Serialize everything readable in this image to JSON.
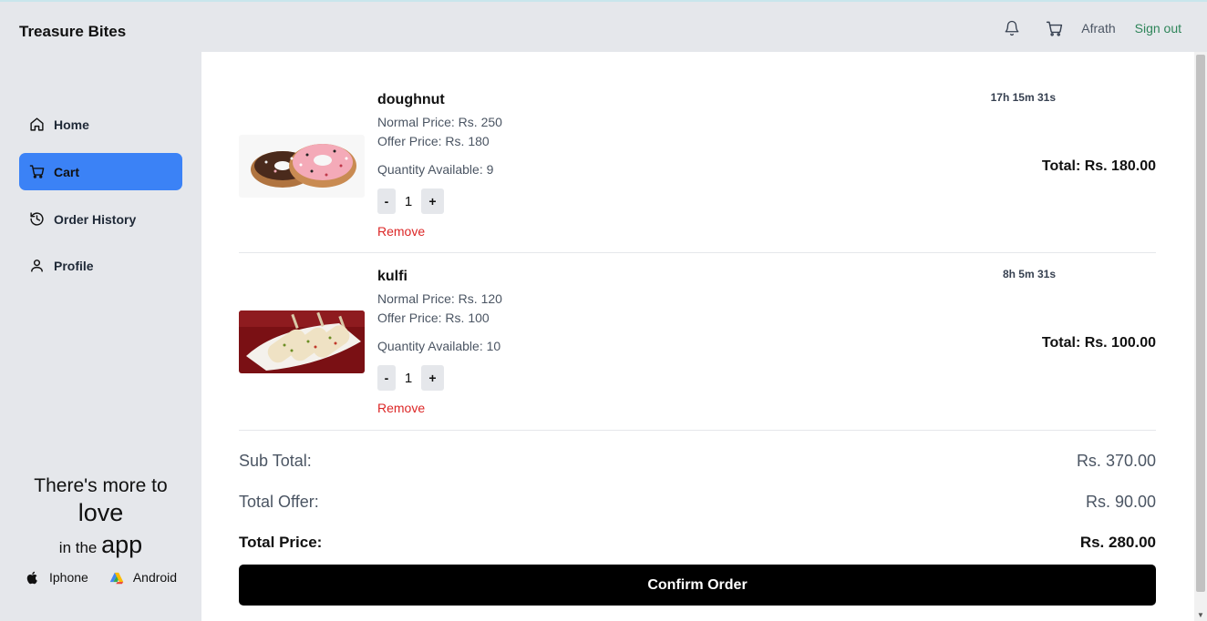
{
  "app": {
    "brand": "Treasure Bites"
  },
  "header": {
    "user_name": "Afrath",
    "sign_out_label": "Sign out",
    "icons": [
      "bell-icon",
      "cart-icon"
    ]
  },
  "sidebar": {
    "items": [
      {
        "label": "Home",
        "icon": "home-icon",
        "active": false
      },
      {
        "label": "Cart",
        "icon": "cart-icon",
        "active": true
      },
      {
        "label": "Order History",
        "icon": "history-icon",
        "active": false
      },
      {
        "label": "Profile",
        "icon": "user-icon",
        "active": false
      }
    ],
    "promo": {
      "line1": "There's more to",
      "line2": "love",
      "line3_prefix": "in the",
      "line3_big": "app"
    },
    "stores": [
      {
        "label": "Iphone",
        "icon": "apple-icon"
      },
      {
        "label": "Android",
        "icon": "android-icon"
      }
    ]
  },
  "cart": {
    "items": [
      {
        "name": "doughnut",
        "normal_price": "Normal Price: Rs. 250",
        "offer_price": "Offer Price: Rs. 180",
        "quantity_available": "Quantity Available: 9",
        "quantity": "1",
        "minus_label": "-",
        "plus_label": "+",
        "remove_label": "Remove",
        "timer": "17h 15m 31s",
        "total": "Total: Rs. 180.00"
      },
      {
        "name": "kulfi",
        "normal_price": "Normal Price: Rs. 120",
        "offer_price": "Offer Price: Rs. 100",
        "quantity_available": "Quantity Available: 10",
        "quantity": "1",
        "minus_label": "-",
        "plus_label": "+",
        "remove_label": "Remove",
        "timer": "8h 5m 31s",
        "total": "Total: Rs. 100.00"
      }
    ],
    "summary": {
      "sub_total_label": "Sub Total:",
      "sub_total_value": "Rs. 370.00",
      "total_offer_label": "Total Offer:",
      "total_offer_value": "Rs. 90.00",
      "total_price_label": "Total Price:",
      "total_price_value": "Rs. 280.00"
    },
    "confirm_label": "Confirm Order"
  },
  "colors": {
    "accent": "#3b82f6",
    "sign_out": "#2f855a",
    "remove": "#dc2626",
    "confirm_bg": "#000000"
  }
}
